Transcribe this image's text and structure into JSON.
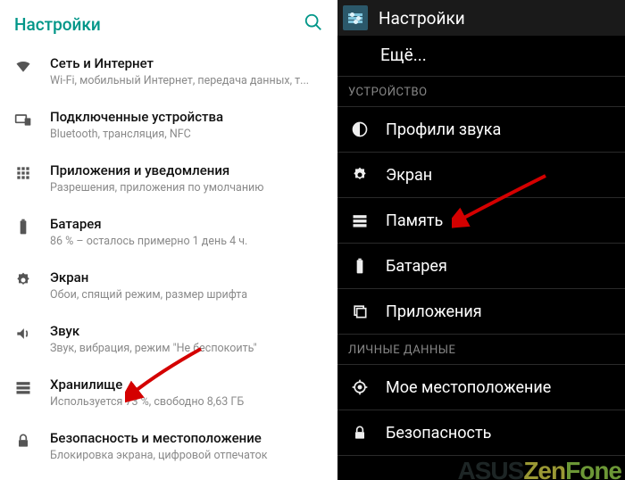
{
  "left": {
    "title": "Настройки",
    "items": [
      {
        "title": "Сеть и Интернет",
        "sub": "Wi-Fi, мобильный Интернет, передача данных, т..."
      },
      {
        "title": "Подключенные устройства",
        "sub": "Bluetooth, трансляция, NFC"
      },
      {
        "title": "Приложения и уведомления",
        "sub": "Разрешения, приложения по умолчанию"
      },
      {
        "title": "Батарея",
        "sub": "86 % – осталось примерно 1 день 4 ч."
      },
      {
        "title": "Экран",
        "sub": "Обои, спящий режим, размер шрифта"
      },
      {
        "title": "Звук",
        "sub": "Звук, вибрация, режим \"Не беспокоить\""
      },
      {
        "title": "Хранилище",
        "sub": "Используется 73 %, свободно 8,63 ГБ"
      },
      {
        "title": "Безопасность и местоположение",
        "sub": "Блокировка экрана, цифровой отпечаток"
      }
    ]
  },
  "right": {
    "title": "Настройки",
    "more": "Ещё...",
    "section_device": "УСТРОЙСТВО",
    "section_personal": "ЛИЧНЫЕ ДАННЫЕ",
    "device_items": [
      {
        "label": "Профили звука"
      },
      {
        "label": "Экран"
      },
      {
        "label": "Память"
      },
      {
        "label": "Батарея"
      },
      {
        "label": "Приложения"
      }
    ],
    "personal_items": [
      {
        "label": "Мое местоположение"
      },
      {
        "label": "Безопасность"
      }
    ]
  },
  "watermark": {
    "a": "ASUS",
    "b": "Zen",
    "c": "Fone"
  }
}
